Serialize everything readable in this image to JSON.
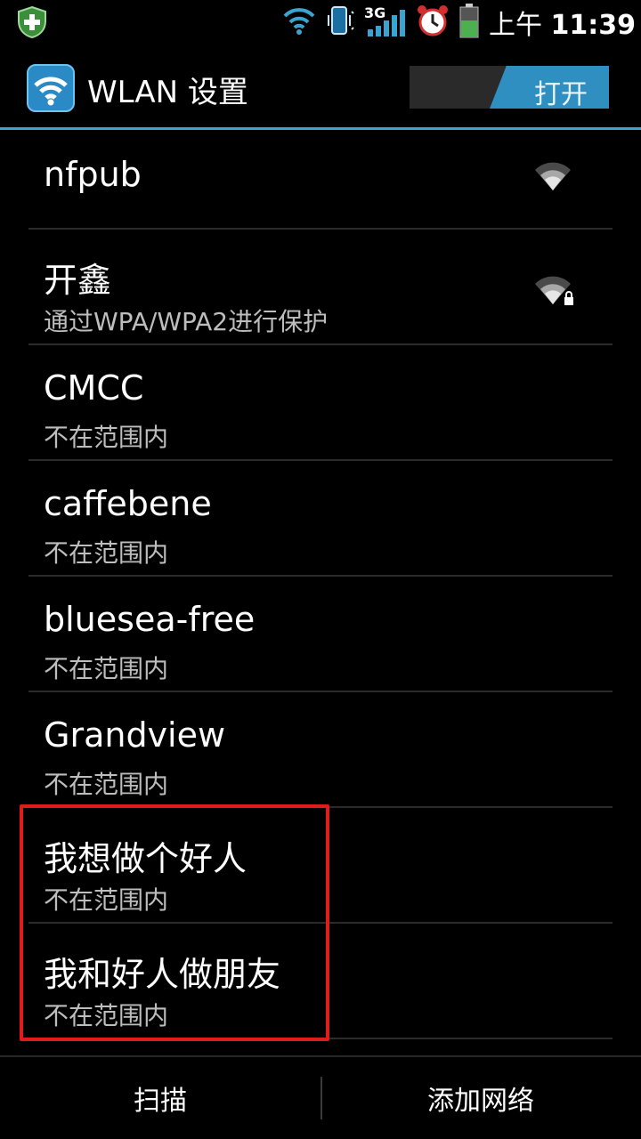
{
  "status_bar": {
    "time_prefix": "上午",
    "time": "11:39",
    "network_label": "3G",
    "icons": [
      "shield-plus-icon",
      "wifi-icon",
      "vibrate-icon",
      "signal-icon",
      "alarm-icon",
      "battery-icon"
    ],
    "accent_green": "#4caf50"
  },
  "title_bar": {
    "title": "WLAN 设置",
    "toggle_label": "打开",
    "accent_color": "#3aa3d2"
  },
  "networks": [
    {
      "name": "nfpub",
      "status": "",
      "signal_icon": "wifi-signal-icon"
    },
    {
      "name": "开鑫",
      "status": "通过WPA/WPA2进行保护",
      "signal_icon": "wifi-secure-icon"
    },
    {
      "name": "CMCC",
      "status": "不在范围内"
    },
    {
      "name": "caffebene",
      "status": "不在范围内"
    },
    {
      "name": "bluesea-free",
      "status": "不在范围内"
    },
    {
      "name": "Grandview",
      "status": "不在范围内"
    },
    {
      "name": "我想做个好人",
      "status": "不在范围内"
    },
    {
      "name": "我和好人做朋友",
      "status": "不在范围内"
    }
  ],
  "highlight_color": "#e01b1b",
  "bottom_bar": {
    "scan_label": "扫描",
    "add_network_label": "添加网络"
  }
}
